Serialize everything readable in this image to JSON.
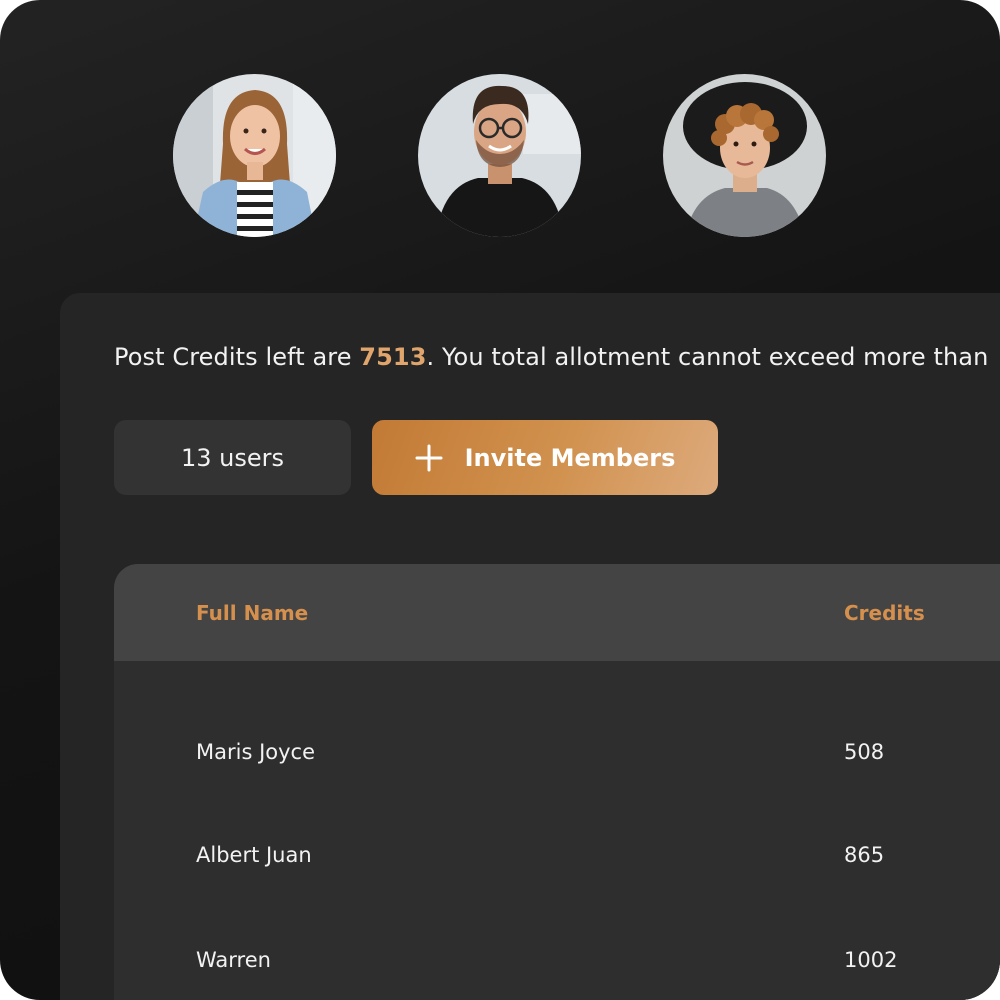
{
  "avatars": [
    {
      "name": "avatar-woman-denim-jacket"
    },
    {
      "name": "avatar-man-glasses"
    },
    {
      "name": "avatar-man-hat"
    }
  ],
  "credits": {
    "prefix": "Post Credits left are ",
    "value": "7513",
    "suffix": ". You total allotment cannot exceed more than"
  },
  "toolbar": {
    "users_count": "13 users",
    "invite_label": "Invite Members",
    "invite_icon": "plus-icon"
  },
  "table": {
    "headers": [
      "Full Name",
      "Credits"
    ],
    "rows": [
      {
        "name": "Maris Joyce",
        "credits": "508"
      },
      {
        "name": "Albert Juan",
        "credits": "865"
      },
      {
        "name": "Warren",
        "credits": "1002"
      }
    ]
  },
  "colors": {
    "accent": "#d6904e",
    "accent_value": "#e0a56c",
    "button_gradient_start": "#c27a35",
    "button_gradient_end": "#ddaa7c",
    "panel": "#252525",
    "table_header": "#444444"
  }
}
